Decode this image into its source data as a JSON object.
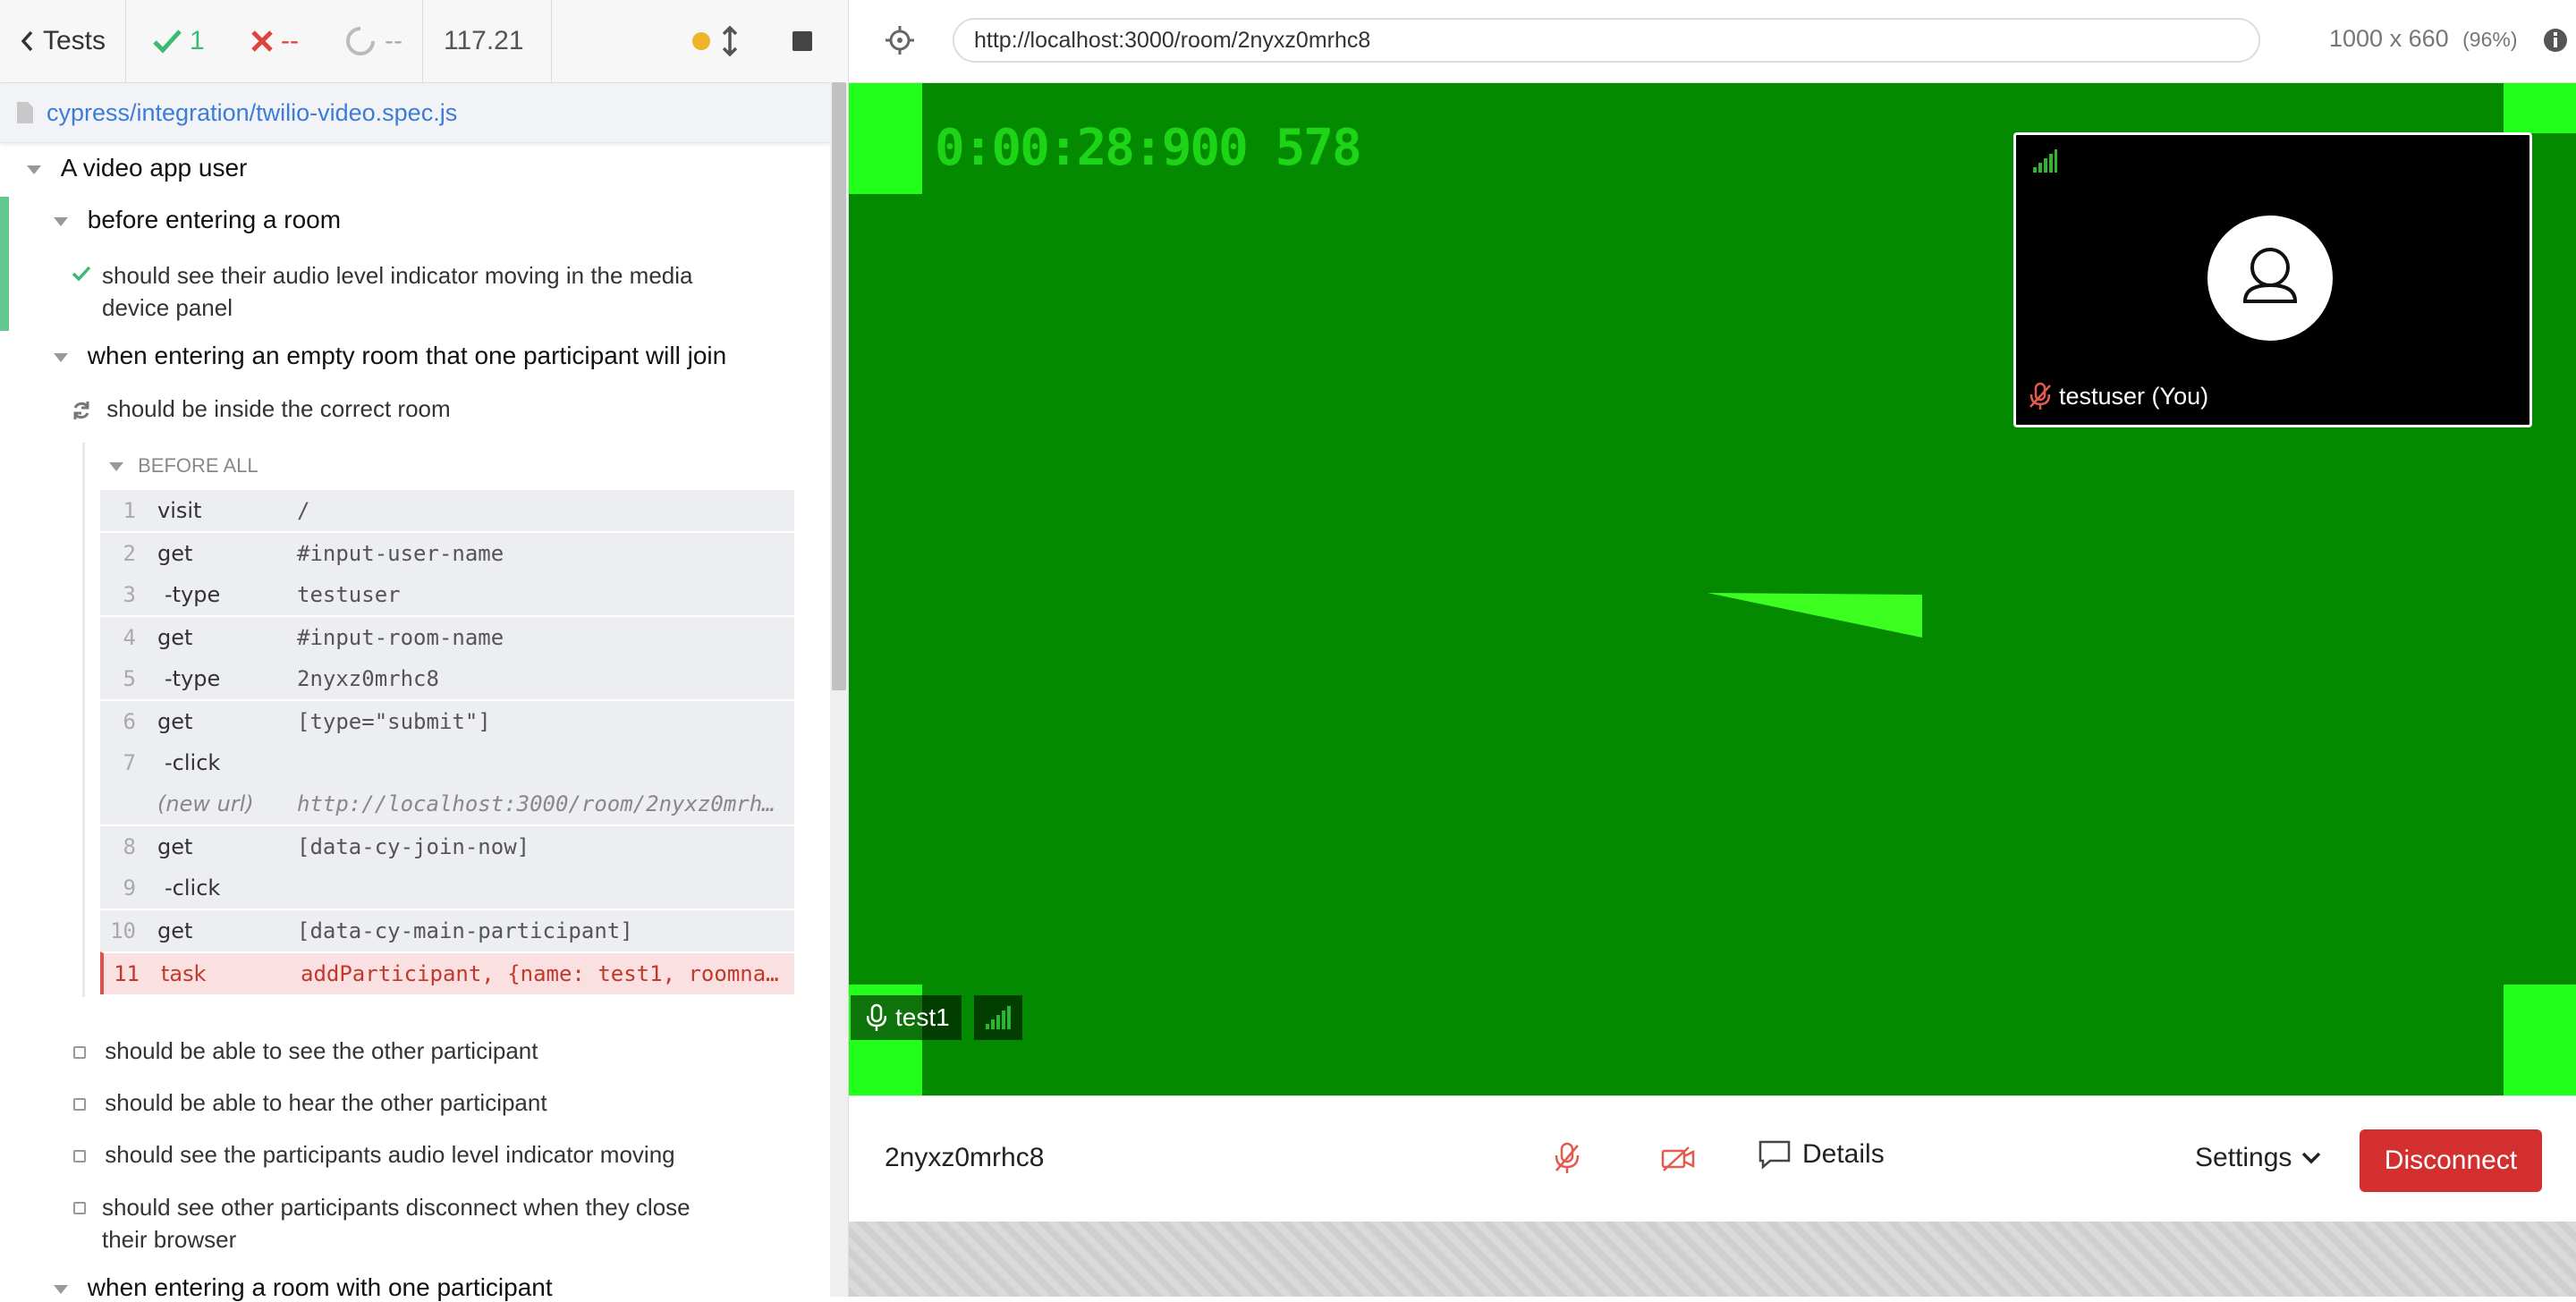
{
  "reporter": {
    "back_label": "Tests",
    "passed_count": "1",
    "failed_count": "--",
    "pending_count": "--",
    "duration": "117.21",
    "spec_path": "cypress/integration/twilio-video.spec.js",
    "root_suite": "A video app user",
    "suite1": "before entering a room",
    "test1": [
      "should see their audio level indicator moving in the media",
      "device panel"
    ],
    "suite2": "when entering an empty room that one participant will join",
    "test2": "should be inside the correct room",
    "hook_label": "BEFORE ALL",
    "commands": [
      {
        "num": "1",
        "name": "visit",
        "message": "/"
      },
      {
        "num": "2",
        "name": "get",
        "message": "#input-user-name"
      },
      {
        "num": "3",
        "name": "-type",
        "message": "testuser"
      },
      {
        "num": "4",
        "name": "get",
        "message": "#input-room-name"
      },
      {
        "num": "5",
        "name": "-type",
        "message": "2nyxz0mrhc8"
      },
      {
        "num": "6",
        "name": "get",
        "message": "[type=\"submit\"]"
      },
      {
        "num": "7",
        "name": "-click",
        "message": ""
      },
      {
        "num": "",
        "name": "(new url)",
        "message": "http://localhost:3000/room/2nyxz0mrh…"
      },
      {
        "num": "8",
        "name": "get",
        "message": "[data-cy-join-now]"
      },
      {
        "num": "9",
        "name": "-click",
        "message": ""
      },
      {
        "num": "10",
        "name": "get",
        "message": "[data-cy-main-participant]"
      },
      {
        "num": "11",
        "name": "task",
        "message": "addParticipant, {name: test1, roomna…"
      }
    ],
    "pending_tests": [
      "should be able to see the other participant",
      "should be able to hear the other participant",
      "should see the participants audio level indicator moving"
    ],
    "pending_test_multi": [
      "should see other participants disconnect when they close",
      "their browser"
    ],
    "suite3": "when entering a room with one participant"
  },
  "aut": {
    "url": "http://localhost:3000/room/2nyxz0mrhc8",
    "viewport_size": "1000 x 660",
    "viewport_scale": "(96%)",
    "timestamp_overlay": "0:00:28:900 578",
    "self_participant": "testuser (You)",
    "main_participant": "test1",
    "room_name": "2nyxz0mrhc8",
    "details_label": "Details",
    "settings_label": "Settings",
    "disconnect_label": "Disconnect"
  },
  "colors": {
    "pass": "#3cba74",
    "fail": "#e0433b",
    "running": "#f0b429",
    "video_bg": "#048a00",
    "accent_link": "#3b7dd8",
    "disconnect": "#d32f2f"
  }
}
